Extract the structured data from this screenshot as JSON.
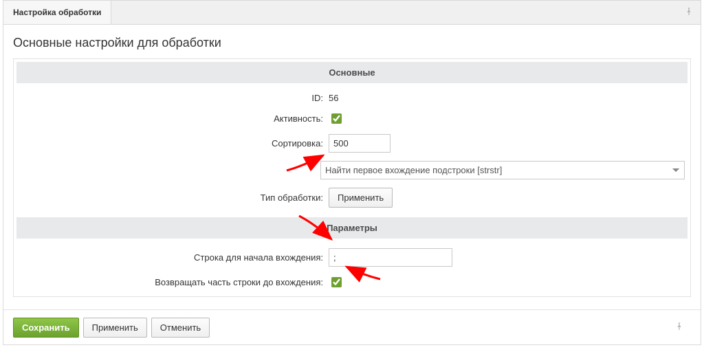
{
  "tab": {
    "label": "Настройка обработки"
  },
  "panel": {
    "title": "Основные настройки для обработки"
  },
  "sections": {
    "main": {
      "header": "Основные",
      "id_label": "ID:",
      "id_value": "56",
      "active_label": "Активность:",
      "sort_label": "Сортировка:",
      "sort_value": "500",
      "type_label": "Тип обработки:",
      "type_selected": "Найти первое вхождение подстроки [strstr]",
      "apply_button": "Применить"
    },
    "params": {
      "header": "Параметры",
      "start_label": "Строка для начала вхождения:",
      "start_value": ";",
      "return_label": "Возвращать часть строки до вхождения:"
    }
  },
  "footer": {
    "save": "Сохранить",
    "apply": "Применить",
    "cancel": "Отменить"
  }
}
